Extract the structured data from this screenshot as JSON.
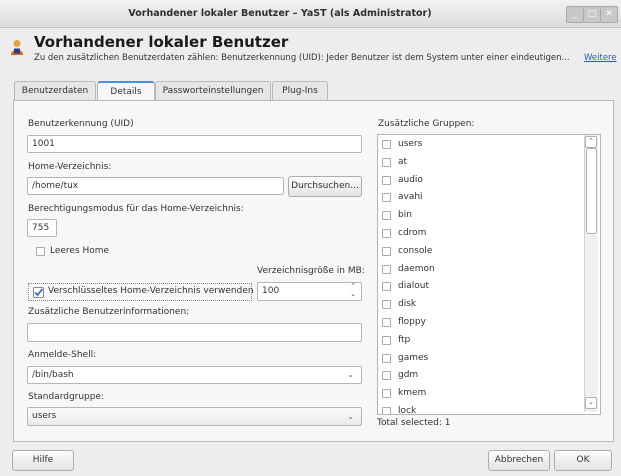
{
  "window": {
    "title": "Vorhandener lokaler Benutzer – YaST (als Administrator)",
    "min_glyph": "_",
    "max_glyph": "□",
    "close_glyph": "✕"
  },
  "header": {
    "title": "Vorhandener lokaler Benutzer",
    "description": "Zu den zusätzlichen Benutzerdaten zählen: Benutzerkennung (UID): Jeder Benutzer ist dem System unter einer eindeutigen...",
    "link": "Weitere"
  },
  "tabs": [
    {
      "label": "Benutzerdaten"
    },
    {
      "label": "Details",
      "active": true
    },
    {
      "label": "Passworteinstellungen"
    },
    {
      "label": "Plug-Ins"
    }
  ],
  "form": {
    "uid_label": "Benutzerkennung (UID)",
    "uid_value": "1001",
    "home_label": "Home-Verzeichnis:",
    "home_value": "/home/tux",
    "browse_button": "Durchsuchen...",
    "perm_label": "Berechtigungsmodus für das Home-Verzeichnis:",
    "perm_value": "755",
    "empty_home_label": "Leeres Home",
    "empty_home_checked": false,
    "dirsize_label": "Verzeichnisgröße in MB:",
    "encrypted_label": "Verschlüsseltes Home-Verzeichnis verwenden",
    "encrypted_checked": true,
    "dirsize_value": "100",
    "extra_info_label": "Zusätzliche Benutzerinformationen:",
    "extra_info_value": "",
    "shell_label": "Anmelde-Shell:",
    "shell_value": "/bin/bash",
    "group_label": "Standardgruppe:",
    "group_value": "users"
  },
  "groups": {
    "label": "Zusätzliche Gruppen:",
    "items": [
      {
        "name": "users"
      },
      {
        "name": "at"
      },
      {
        "name": "audio"
      },
      {
        "name": "avahi"
      },
      {
        "name": "bin"
      },
      {
        "name": "cdrom"
      },
      {
        "name": "console"
      },
      {
        "name": "daemon"
      },
      {
        "name": "dialout"
      },
      {
        "name": "disk"
      },
      {
        "name": "floppy"
      },
      {
        "name": "ftp"
      },
      {
        "name": "games"
      },
      {
        "name": "gdm"
      },
      {
        "name": "kmem"
      },
      {
        "name": "lock"
      }
    ],
    "total": "Total selected: 1"
  },
  "footer": {
    "help_button": "Hilfe",
    "cancel_button": "Abbrechen",
    "ok_button": "OK"
  },
  "colors": {
    "accent": "#4a90d9",
    "link": "#2a5db0"
  }
}
